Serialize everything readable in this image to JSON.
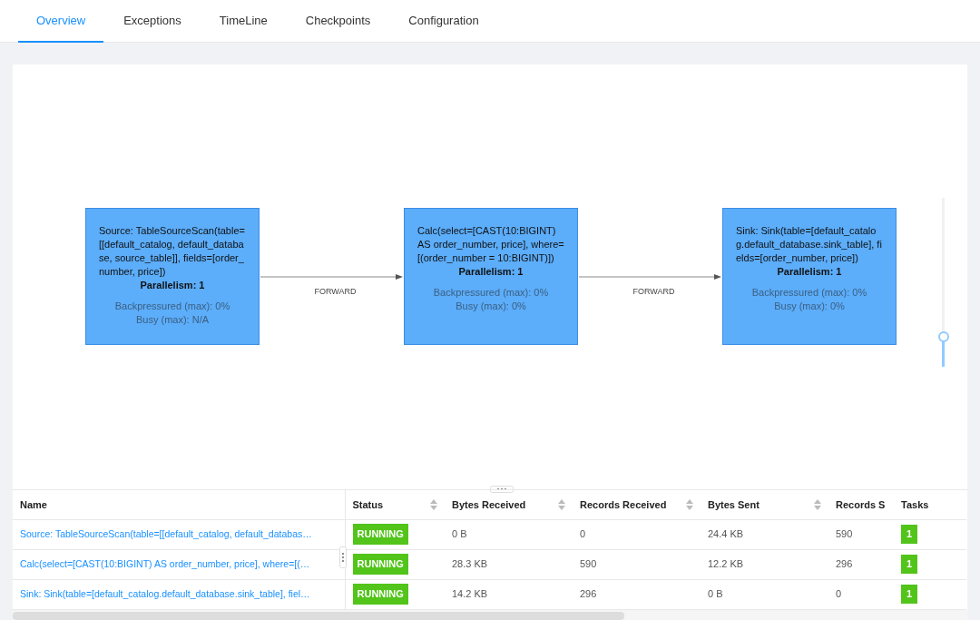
{
  "tabs": [
    {
      "label": "Overview",
      "selected": true
    },
    {
      "label": "Exceptions",
      "selected": false
    },
    {
      "label": "TimeLine",
      "selected": false
    },
    {
      "label": "Checkpoints",
      "selected": false
    },
    {
      "label": "Configuration",
      "selected": false
    }
  ],
  "graph": {
    "nodes": [
      {
        "label": "Source: TableSourceScan(table=[[default_catalog, default_database, source_table]], fields=[order_number, price])",
        "parallelism": "Parallelism: 1",
        "backpressured": "Backpressured (max): 0%",
        "busy": "Busy (max): N/A"
      },
      {
        "label": "Calc(select=[CAST(10:BIGINT) AS order_number, price], where=[(order_number = 10:BIGINT)])",
        "parallelism": "Parallelism: 1",
        "backpressured": "Backpressured (max): 0%",
        "busy": "Busy (max): 0%"
      },
      {
        "label": "Sink: Sink(table=[default_catalog.default_database.sink_table], fields=[order_number, price])",
        "parallelism": "Parallelism: 1",
        "backpressured": "Backpressured (max): 0%",
        "busy": "Busy (max): 0%"
      }
    ],
    "edges": [
      {
        "label": "FORWARD"
      },
      {
        "label": "FORWARD"
      }
    ],
    "zoom_slider": {
      "level": 0.18
    }
  },
  "table": {
    "columns": [
      {
        "label": "Name",
        "sortable": false
      },
      {
        "label": "Status",
        "sortable": true
      },
      {
        "label": "Bytes Received",
        "sortable": true
      },
      {
        "label": "Records Received",
        "sortable": true
      },
      {
        "label": "Bytes Sent",
        "sortable": true
      },
      {
        "label": "Records S",
        "sortable": false
      },
      {
        "label": "Tasks",
        "sortable": false
      }
    ],
    "rows": [
      {
        "name": "Source: TableSourceScan(table=[[default_catalog, default_databas…",
        "status": "RUNNING",
        "bytes_received": "0 B",
        "records_received": "0",
        "bytes_sent": "24.4 KB",
        "records_sent": "590",
        "tasks": "1"
      },
      {
        "name": "Calc(select=[CAST(10:BIGINT) AS order_number, price], where=[(…",
        "status": "RUNNING",
        "bytes_received": "28.3 KB",
        "records_received": "590",
        "bytes_sent": "12.2 KB",
        "records_sent": "296",
        "tasks": "1"
      },
      {
        "name": "Sink: Sink(table=[default_catalog.default_database.sink_table], fiel…",
        "status": "RUNNING",
        "bytes_received": "14.2 KB",
        "records_received": "296",
        "bytes_sent": "0 B",
        "records_sent": "0",
        "tasks": "1"
      }
    ]
  }
}
